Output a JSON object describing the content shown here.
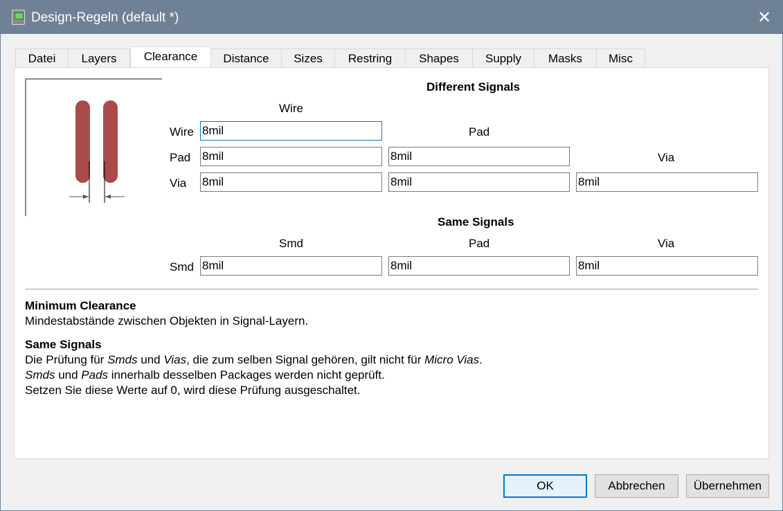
{
  "window": {
    "title": "Design-Regeln (default *)",
    "close_glyph": "✕"
  },
  "tabs": [
    {
      "label": "Datei"
    },
    {
      "label": "Layers"
    },
    {
      "label": "Clearance"
    },
    {
      "label": "Distance"
    },
    {
      "label": "Sizes"
    },
    {
      "label": "Restring"
    },
    {
      "label": "Shapes"
    },
    {
      "label": "Supply"
    },
    {
      "label": "Masks"
    },
    {
      "label": "Misc"
    }
  ],
  "active_tab": "Clearance",
  "different_signals": {
    "heading": "Different Signals",
    "col_wire": "Wire",
    "col_pad": "Pad",
    "col_via": "Via",
    "row_wire": "Wire",
    "row_pad": "Pad",
    "row_via": "Via",
    "wire_wire": "8mil",
    "pad_wire": "8mil",
    "pad_pad": "8mil",
    "via_wire": "8mil",
    "via_pad": "8mil",
    "via_via": "8mil"
  },
  "same_signals": {
    "heading": "Same Signals",
    "col_smd": "Smd",
    "col_pad": "Pad",
    "col_via": "Via",
    "row_smd": "Smd",
    "smd_smd": "8mil",
    "smd_pad": "8mil",
    "smd_via": "8mil"
  },
  "description": {
    "title1": "Minimum Clearance",
    "line1": "Mindestabstände zwischen Objekten in Signal-Layern.",
    "title2": "Same Signals",
    "line2_a": "Die Prüfung für ",
    "line2_b": "Smds",
    "line2_c": " und ",
    "line2_d": "Vias",
    "line2_e": ", die zum selben Signal gehören, gilt nicht für ",
    "line2_f": "Micro Vias",
    "line2_g": ".",
    "line3_a": "Smds",
    "line3_b": " und ",
    "line3_c": "Pads",
    "line3_d": " innerhalb desselben Packages werden nicht geprüft.",
    "line4": "Setzen Sie diese Werte auf 0, wird diese Prüfung ausgeschaltet."
  },
  "buttons": {
    "ok": "OK",
    "cancel": "Abbrechen",
    "apply": "Übernehmen"
  },
  "colors": {
    "titlebar": "#6f8197",
    "pad_fill": "#a94b4b",
    "focus": "#0078d7"
  }
}
